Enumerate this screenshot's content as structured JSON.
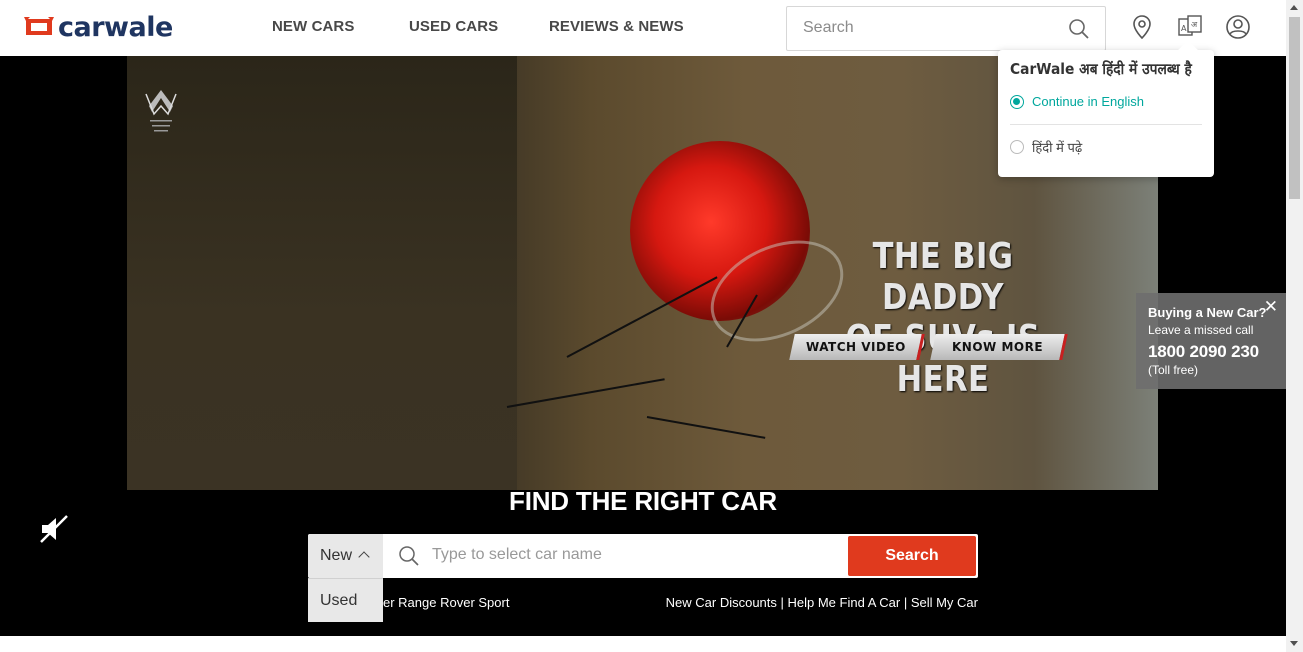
{
  "header": {
    "logo_text": "carwale",
    "brand_color": "#e03a1e",
    "nav": [
      "NEW CARS",
      "USED CARS",
      "REVIEWS & NEWS"
    ],
    "search_placeholder": "Search",
    "icons": [
      "search-icon",
      "location-pin-icon",
      "language-icon",
      "user-profile-icon"
    ]
  },
  "hero": {
    "headline_line1": "THE BIG DADDY",
    "headline_line2": "OF SUVs IS HERE",
    "cta_watch": "WATCH VIDEO",
    "cta_know": "KNOW MORE",
    "brand_logo": "mahindra-suv-logo"
  },
  "finder": {
    "title": "FIND THE RIGHT CAR",
    "type_selected": "New",
    "type_options": [
      "Used"
    ],
    "input_placeholder": "Type to select car name",
    "search_label": "Search",
    "quick_left": "er Range Rover Sport",
    "quick_right": "New Car Discounts | Help Me Find A Car | Sell My Car"
  },
  "language_popup": {
    "title": "CarWale अब हिंदी में उपलब्ध है",
    "option_english": "Continue in English",
    "option_hindi": "हिंदी में पढ़े",
    "accent": "#00a79d"
  },
  "callback": {
    "title": "Buying a New Car?",
    "subtitle": "Leave a missed call",
    "number": "1800 2090 230",
    "note": "(Toll free)",
    "close": "✕"
  }
}
